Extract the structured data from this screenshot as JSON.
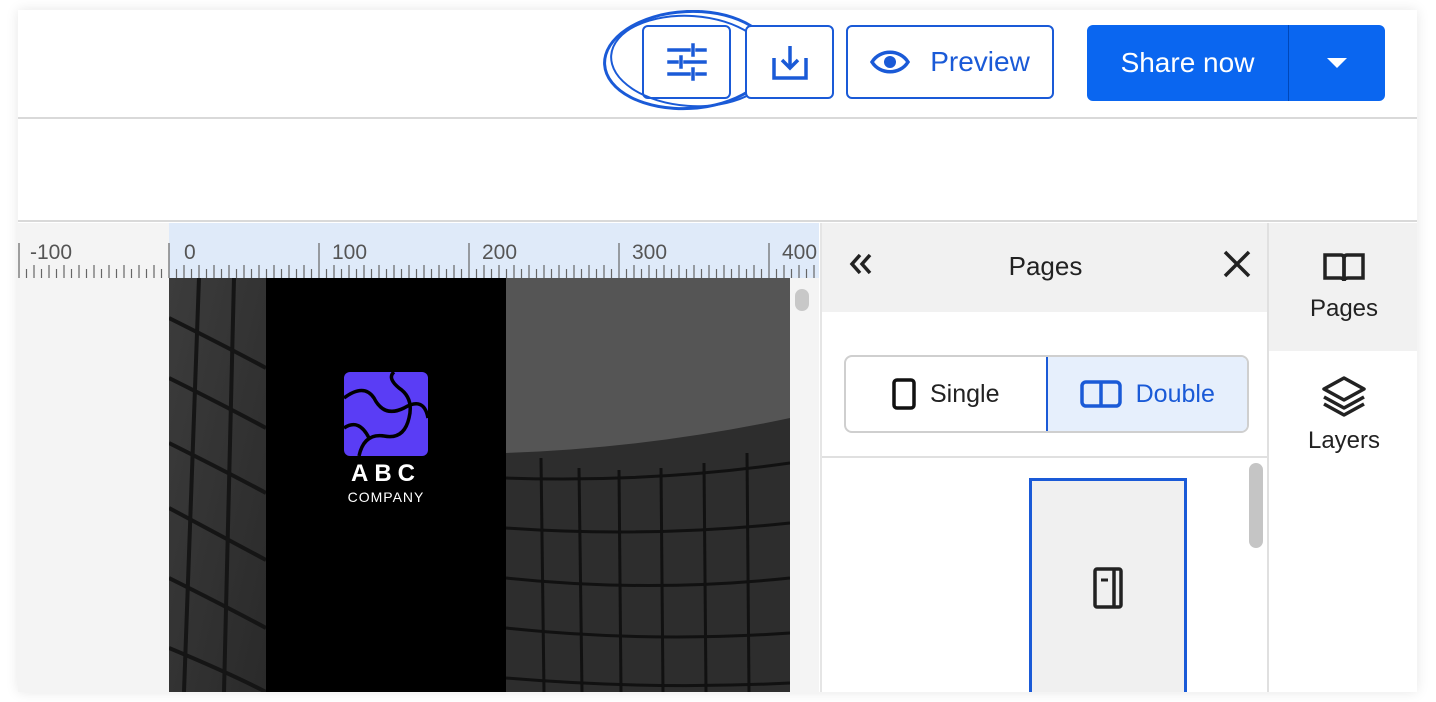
{
  "toolbar": {
    "settings_icon": "sliders-icon",
    "download_icon": "download-icon",
    "preview_label": "Preview",
    "preview_icon": "eye-icon",
    "share_label": "Share now",
    "share_caret_icon": "caret-down-icon"
  },
  "ruler": {
    "labels": [
      "-100",
      "0",
      "100",
      "200",
      "300",
      "400"
    ]
  },
  "document": {
    "logo_title": "ABC",
    "logo_subtitle": "COMPANY",
    "logo_color": "#5a3df5"
  },
  "pages_panel": {
    "title": "Pages",
    "collapse_icon": "double-chevron-left-icon",
    "close_icon": "close-icon",
    "view_options": [
      {
        "label": "Single",
        "icon": "single-page-icon",
        "active": false
      },
      {
        "label": "Double",
        "icon": "double-page-icon",
        "active": true
      }
    ],
    "thumbnail_icon": "book-page-icon"
  },
  "rail": {
    "items": [
      {
        "label": "Pages",
        "icon": "open-book-icon",
        "active": true
      },
      {
        "label": "Layers",
        "icon": "layers-icon",
        "active": false
      }
    ]
  },
  "colors": {
    "accent": "#0a66f0",
    "outline": "#1a5ad7"
  }
}
